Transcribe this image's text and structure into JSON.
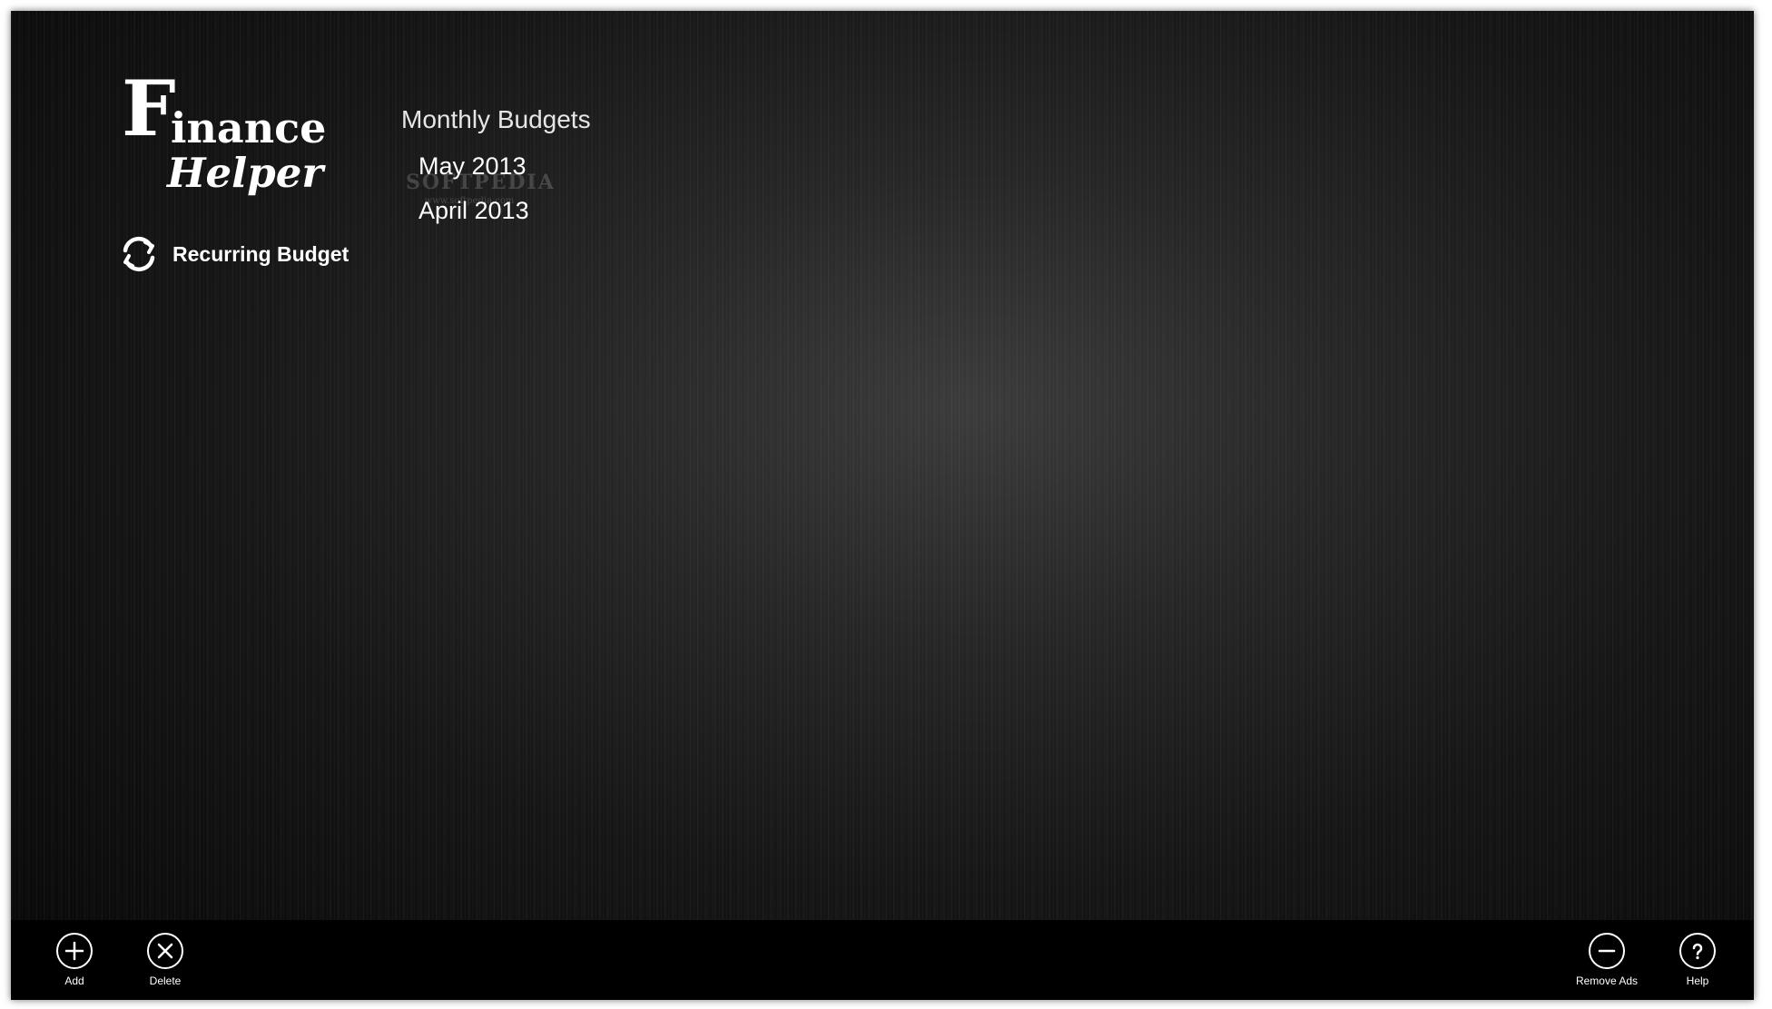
{
  "app": {
    "logo_initial": "F",
    "logo_line1": "inance",
    "logo_line2": "Helper"
  },
  "sidebar": {
    "recurring_label": "Recurring Budget"
  },
  "budgets": {
    "heading": "Monthly Budgets",
    "items": [
      {
        "label": "May 2013"
      },
      {
        "label": "April 2013"
      }
    ]
  },
  "watermark": {
    "name": "SOFTPEDIA",
    "url": "www.softpedia.com"
  },
  "appbar": {
    "add_label": "Add",
    "delete_label": "Delete",
    "remove_ads_label": "Remove Ads",
    "help_label": "Help"
  },
  "colors": {
    "text": "#ffffff",
    "appbar_background": "#000000",
    "background_center": "#3b3b3b",
    "background_edge": "#070707"
  },
  "icons": {
    "recurring": "refresh-icon",
    "add": "plus-circle-icon",
    "delete": "x-circle-icon",
    "remove_ads": "minus-circle-icon",
    "help": "question-circle-icon"
  }
}
